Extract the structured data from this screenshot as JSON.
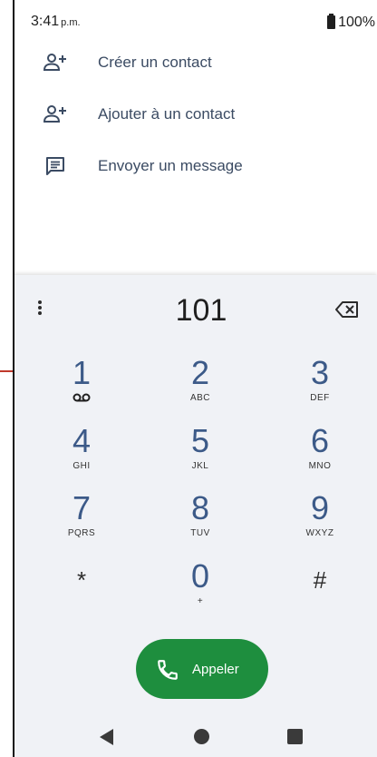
{
  "status_bar": {
    "time": "3:41",
    "ampm": "p.m.",
    "battery": "100%"
  },
  "actions": [
    {
      "label": "Créer un contact",
      "icon": "person-add-icon"
    },
    {
      "label": "Ajouter à un contact",
      "icon": "person-add-icon"
    },
    {
      "label": "Envoyer un message",
      "icon": "message-icon"
    }
  ],
  "dialpad": {
    "digits": "101",
    "keys": [
      {
        "num": "1",
        "sub": "voicemail-icon"
      },
      {
        "num": "2",
        "sub": "ABC"
      },
      {
        "num": "3",
        "sub": "DEF"
      },
      {
        "num": "4",
        "sub": "GHI"
      },
      {
        "num": "5",
        "sub": "JKL"
      },
      {
        "num": "6",
        "sub": "MNO"
      },
      {
        "num": "7",
        "sub": "PQRS"
      },
      {
        "num": "8",
        "sub": "TUV"
      },
      {
        "num": "9",
        "sub": "WXYZ"
      },
      {
        "num": "*",
        "sub": ""
      },
      {
        "num": "0",
        "sub": "+"
      },
      {
        "num": "#",
        "sub": ""
      }
    ],
    "call_label": "Appeler"
  },
  "colors": {
    "accent": "#3c5a88",
    "call": "#1e8e3e",
    "annotation": "#c0392b"
  }
}
